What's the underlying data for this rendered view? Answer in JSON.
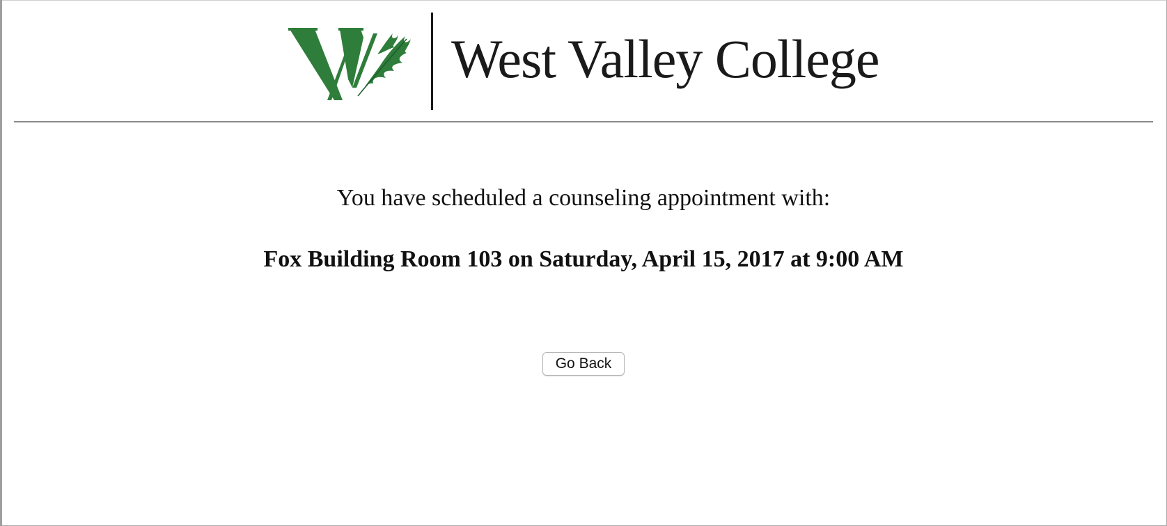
{
  "header": {
    "logo_text": "West Valley College",
    "logo_mark_letter": "W",
    "brand_green": "#2e7d3a"
  },
  "confirmation": {
    "intro": "You have scheduled a counseling appointment with:",
    "detail": "Fox Building Room 103 on Saturday, April 15, 2017 at 9:00 AM"
  },
  "actions": {
    "go_back_label": "Go Back"
  },
  "icons": {
    "logo_leaf": "oak-leaf-icon"
  }
}
